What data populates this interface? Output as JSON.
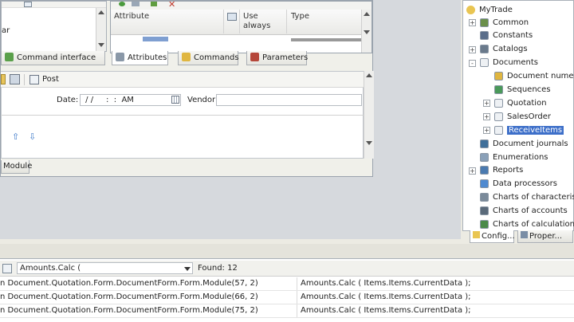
{
  "form_window": {
    "left_text": "ar",
    "attributes_grid": {
      "columns": [
        "Attribute",
        "Use always",
        "Type"
      ]
    },
    "tabs": [
      {
        "label": "Command interface"
      },
      {
        "label": "Attributes"
      },
      {
        "label": "Commands"
      },
      {
        "label": "Parameters"
      }
    ],
    "toolbar": {
      "post_label": "Post"
    },
    "fields": {
      "date_label": "Date:",
      "date_value": " / /     :  :  AM",
      "vendor_label": "Vendor:"
    },
    "module_tab": "Module"
  },
  "config_tree": {
    "root": "MyTrade",
    "items": [
      {
        "label": "Common",
        "indent": 1,
        "expander": "+",
        "icon": "common-icon"
      },
      {
        "label": "Constants",
        "indent": 1,
        "expander": "",
        "icon": "constants-icon"
      },
      {
        "label": "Catalogs",
        "indent": 1,
        "expander": "+",
        "icon": "catalogs-icon"
      },
      {
        "label": "Documents",
        "indent": 1,
        "expander": "-",
        "icon": "documents-icon"
      },
      {
        "label": "Document numerato",
        "indent": 2,
        "expander": "",
        "icon": "numerator-icon"
      },
      {
        "label": "Sequences",
        "indent": 2,
        "expander": "",
        "icon": "sequences-icon"
      },
      {
        "label": "Quotation",
        "indent": 2,
        "expander": "+",
        "icon": "document-icon"
      },
      {
        "label": "SalesOrder",
        "indent": 2,
        "expander": "+",
        "icon": "document-icon"
      },
      {
        "label": "ReceiveItems",
        "indent": 2,
        "expander": "+",
        "icon": "document-icon",
        "selected": true
      },
      {
        "label": "Document journals",
        "indent": 1,
        "expander": "",
        "icon": "journal-icon"
      },
      {
        "label": "Enumerations",
        "indent": 1,
        "expander": "",
        "icon": "enum-icon"
      },
      {
        "label": "Reports",
        "indent": 1,
        "expander": "+",
        "icon": "reports-icon"
      },
      {
        "label": "Data processors",
        "indent": 1,
        "expander": "",
        "icon": "processor-icon"
      },
      {
        "label": "Charts of characteristic t",
        "indent": 1,
        "expander": "",
        "icon": "chart-char-icon"
      },
      {
        "label": "Charts of accounts",
        "indent": 1,
        "expander": "",
        "icon": "accounts-icon"
      },
      {
        "label": "Charts of calculation typ",
        "indent": 1,
        "expander": "",
        "icon": "calc-icon"
      }
    ],
    "bottom_tabs": [
      {
        "label": "Config..."
      },
      {
        "label": "Proper..."
      }
    ]
  },
  "search": {
    "query": "Amounts.Calc (",
    "found_label": "Found: 12",
    "results": [
      {
        "location": "n Document.Quotation.Form.DocumentForm.Form.Module(57, 2)",
        "code": "Amounts.Calc ( Items.Items.CurrentData );"
      },
      {
        "location": "n Document.Quotation.Form.DocumentForm.Form.Module(66, 2)",
        "code": "Amounts.Calc ( Items.Items.CurrentData );"
      },
      {
        "location": "n Document.Quotation.Form.DocumentForm.Form.Module(75, 2)",
        "code": "Amounts.Calc ( Items.Items.CurrentData );"
      }
    ]
  },
  "colors": {
    "selection": "#3d6fc9",
    "accent_blue": "#2e5fa8"
  }
}
